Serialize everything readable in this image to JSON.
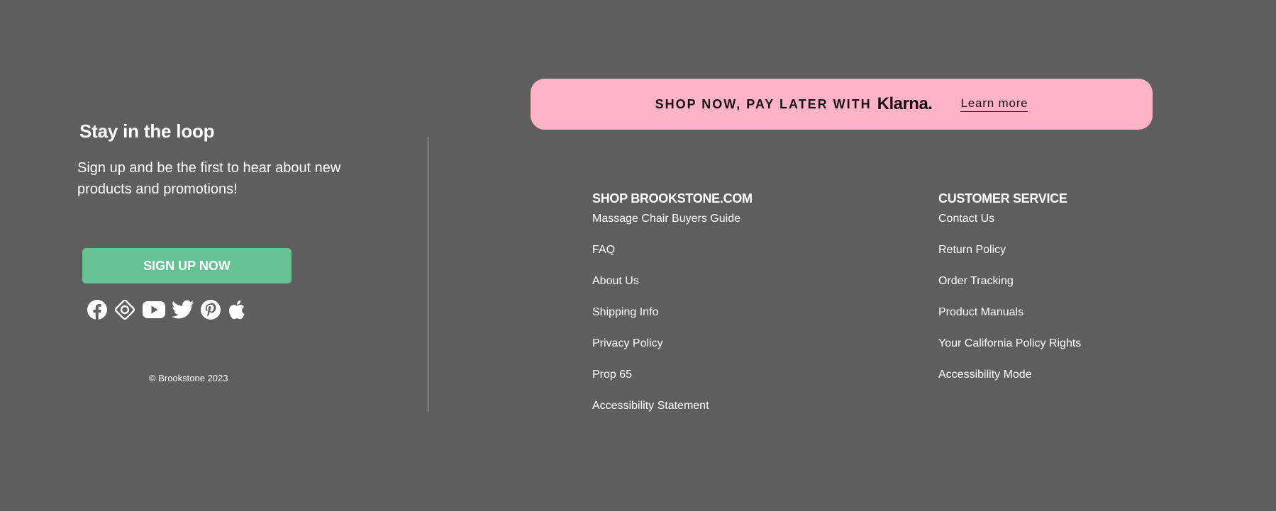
{
  "newsletter": {
    "title": "Stay in the loop",
    "text": "Sign up and be the first to hear about new products and promotions!",
    "button_label": "SIGN UP NOW"
  },
  "socials": [
    {
      "icon": "facebook-icon"
    },
    {
      "icon": "instagram-icon"
    },
    {
      "icon": "youtube-icon"
    },
    {
      "icon": "twitter-icon"
    },
    {
      "icon": "pinterest-icon"
    },
    {
      "icon": "apple-icon"
    }
  ],
  "copyright": "© Brookstone 2023",
  "klarna": {
    "text": "SHOP NOW, PAY LATER WITH",
    "logo": "Klarna.",
    "link": "Learn more",
    "background": "#ffb3c7"
  },
  "shop_column": {
    "heading": "SHOP BROOKSTONE.COM",
    "links": [
      "Massage Chair Buyers Guide",
      "FAQ",
      "About Us",
      "Shipping Info",
      "Privacy Policy",
      "Prop 65",
      "Accessibility Statement"
    ]
  },
  "service_column": {
    "heading": "CUSTOMER SERVICE",
    "links": [
      "Contact Us",
      "Return Policy",
      "Order Tracking",
      "Product Manuals",
      "Your California Policy Rights",
      "Accessibility Mode"
    ]
  },
  "colors": {
    "background": "#5e5e5e",
    "button": "#66c195",
    "text": "#ffffff"
  }
}
